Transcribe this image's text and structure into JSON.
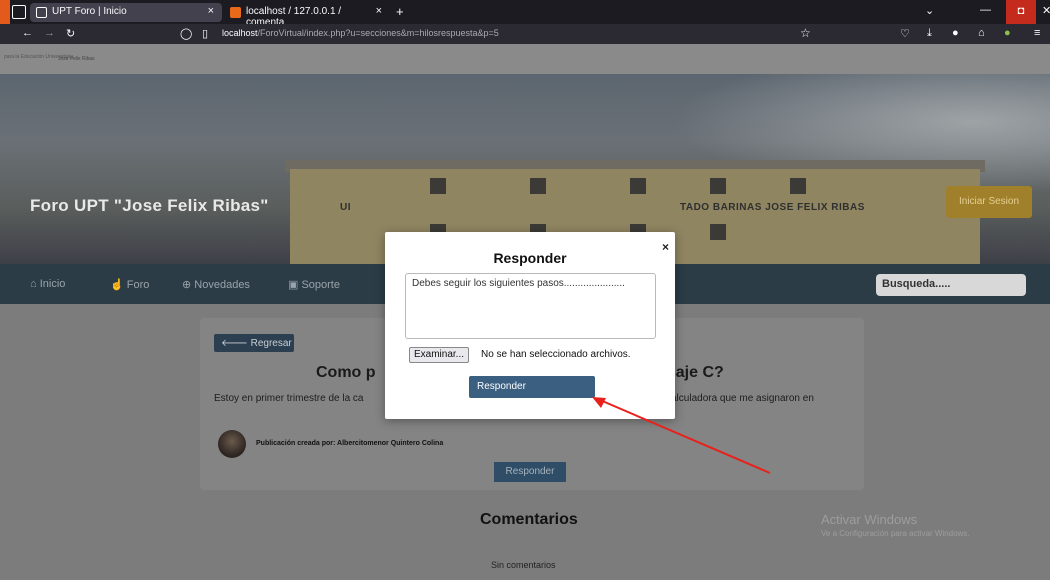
{
  "browser": {
    "tabs": [
      {
        "title": "UPT Foro | Inicio",
        "close": "×"
      },
      {
        "title": "localhost / 127.0.0.1 / comenta",
        "close": "×"
      }
    ],
    "new_tab": "+",
    "url_host": "localhost",
    "url_path": "/ForoVirtual/index.php?u=secciones&m=hilosrespuesta&p=5",
    "window_min": "—",
    "window_max": "◘",
    "window_close": "✕"
  },
  "site": {
    "logo_line1": "para la Educación Universitaria",
    "logo_line2": "Jose Felix Ribas",
    "hero_title": "Foro UPT \"Jose Felix Ribas\"",
    "building_sign": "TADO BARINAS JOSE FELIX RIBAS",
    "building_sign_left": "UI",
    "login_button": "Iniciar Sesion",
    "menu": [
      {
        "label": "Inicio",
        "icon": "home-icon"
      },
      {
        "label": "Foro",
        "icon": "hand-icon"
      },
      {
        "label": "Novedades",
        "icon": "globe-icon"
      },
      {
        "label": "Soporte",
        "icon": "chat-icon"
      }
    ],
    "search_placeholder": "Busqueda....."
  },
  "post": {
    "back_button": "Regresar",
    "title_left": "Como p",
    "title_right": "uaje C?",
    "body_left": "Estoy en primer trimestre de la ca",
    "body_right": "calculadora que me asignaron en",
    "author": "Publicación creada por: Albercitomenor Quintero Colina",
    "reply_button": "Responder"
  },
  "comments": {
    "title": "Comentarios",
    "empty": "Sin comentarios"
  },
  "modal": {
    "title": "Responder",
    "close": "×",
    "textarea_value": "Debes seguir los siguientes pasos......................",
    "file_button": "Examinar...",
    "file_status": "No se han seleccionado archivos.",
    "submit": "Responder"
  },
  "watermark": {
    "line1": "Activar Windows",
    "line2": "Ve a Configuración para activar Windows."
  },
  "colors": {
    "annotation_arrow": "#e8211c",
    "accent_button": "#3a5f80"
  }
}
